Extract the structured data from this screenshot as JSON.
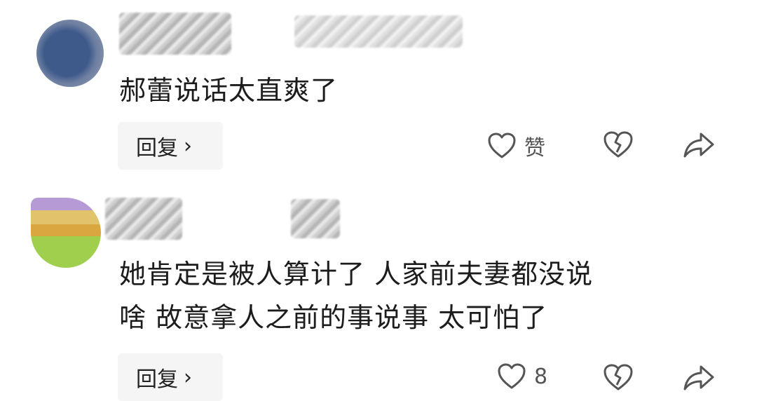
{
  "comments": [
    {
      "text": "郝蕾说话太直爽了",
      "reply_label": "回复",
      "reply_chevron": "›",
      "like_label": "赞",
      "like_icon": "heart-outline-icon",
      "dislike_icon": "broken-heart-icon",
      "share_icon": "share-arrow-icon"
    },
    {
      "text": "她肯定是被人算计了 人家前夫妻都没说\n啥 故意拿人之前的事说事 太可怕了",
      "reply_label": "回复",
      "reply_chevron": "›",
      "like_label": "8",
      "like_icon": "heart-outline-icon",
      "dislike_icon": "broken-heart-icon",
      "share_icon": "share-arrow-icon"
    }
  ]
}
